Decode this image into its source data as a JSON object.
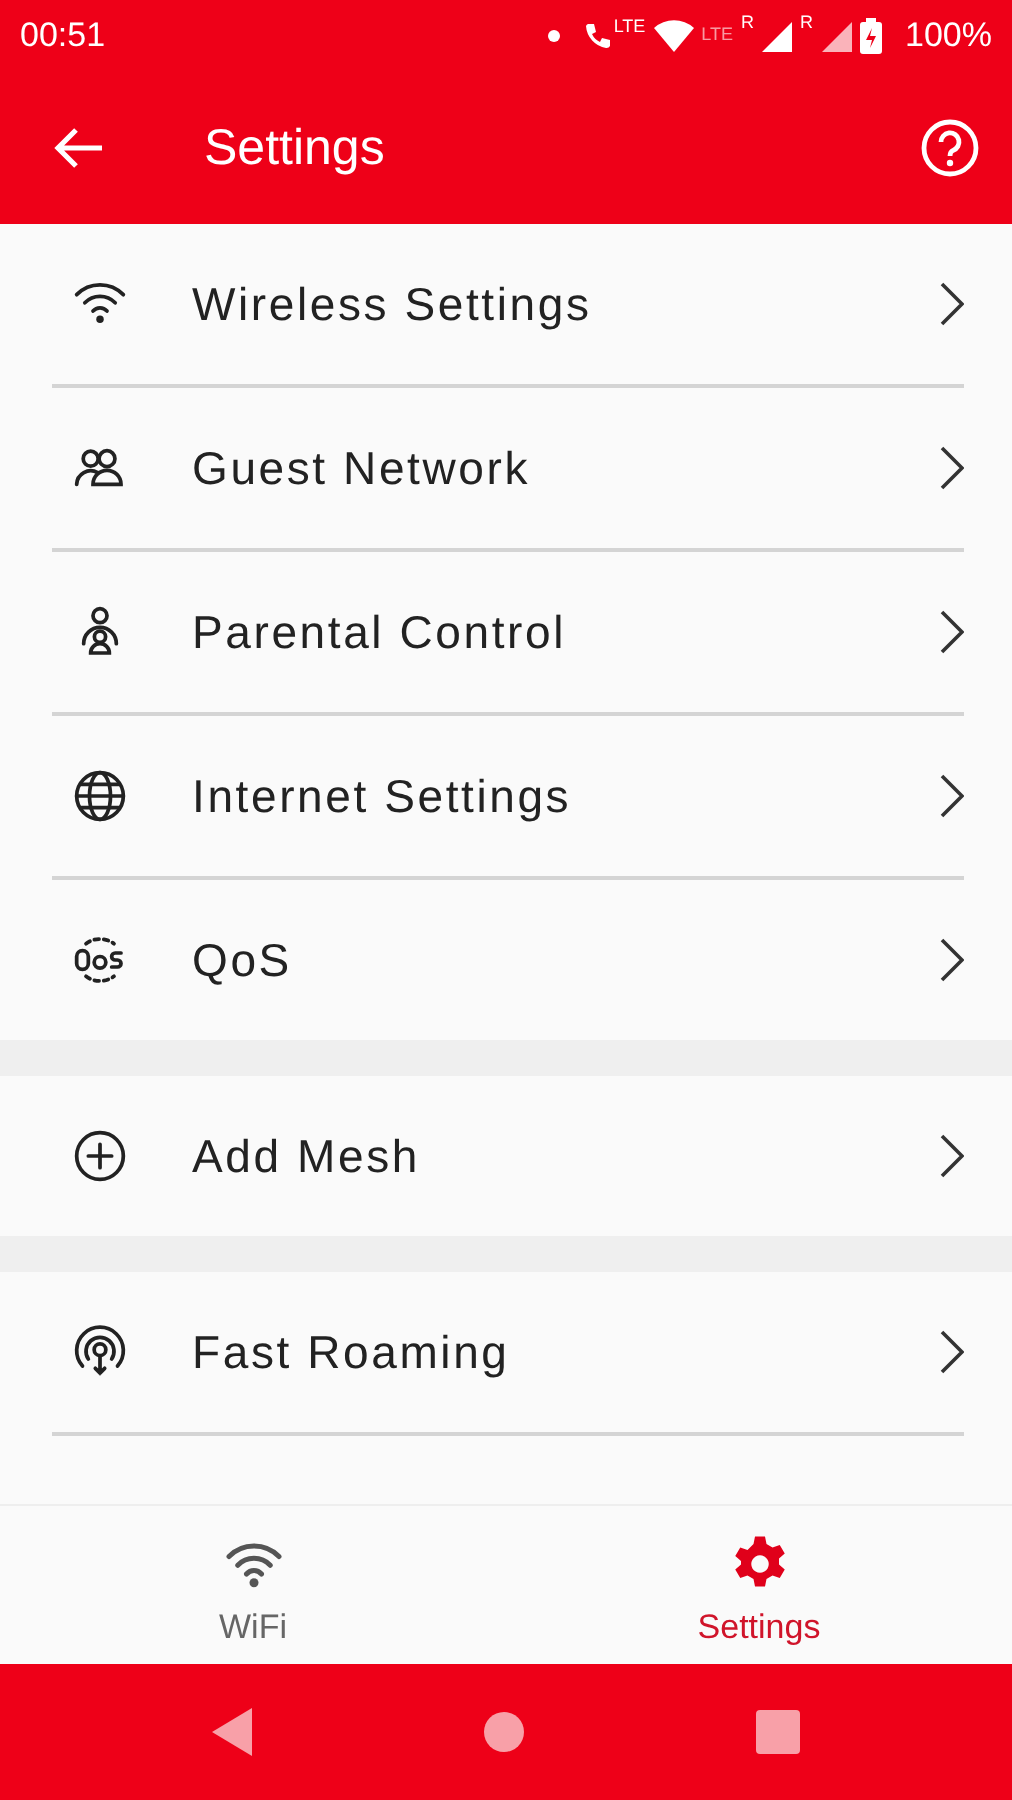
{
  "status_bar": {
    "time": "00:51",
    "call_tag": "LTE",
    "network_tag": "LTE",
    "roaming_tags": [
      "R",
      "R"
    ],
    "battery": "100%"
  },
  "app_bar": {
    "title": "Settings"
  },
  "sections": [
    {
      "items": [
        {
          "label": "Wireless Settings"
        },
        {
          "label": "Guest Network"
        },
        {
          "label": "Parental Control"
        },
        {
          "label": "Internet Settings"
        },
        {
          "label": "QoS"
        }
      ]
    },
    {
      "items": [
        {
          "label": "Add Mesh"
        }
      ]
    },
    {
      "items": [
        {
          "label": "Fast Roaming"
        }
      ]
    }
  ],
  "bottom_nav": [
    {
      "label": "WiFi",
      "selected": false
    },
    {
      "label": "Settings",
      "selected": true
    }
  ]
}
